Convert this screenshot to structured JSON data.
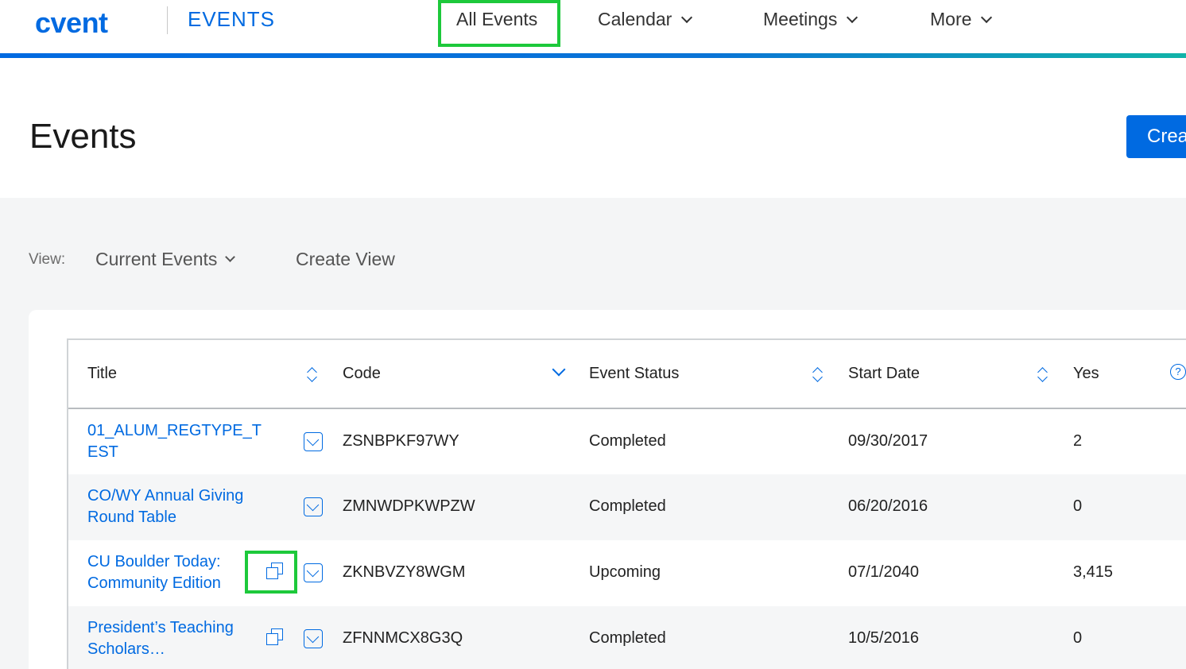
{
  "topnav": {
    "logo": "cvent",
    "app_name": "EVENTS",
    "items": [
      {
        "label": "All Events"
      },
      {
        "label": "Calendar"
      },
      {
        "label": "Meetings"
      },
      {
        "label": "More"
      }
    ]
  },
  "header": {
    "title": "Events",
    "create_button": "Crea"
  },
  "view": {
    "label": "View:",
    "selected": "Current Events",
    "create_view": "Create View"
  },
  "table": {
    "columns": [
      "Title",
      "Code",
      "Event Status",
      "Start Date",
      "Yes"
    ],
    "help_glyph": "?",
    "rows": [
      {
        "title": "01_ALUM_REGTYPE_T EST",
        "code": "ZSNBPKF97WY",
        "status": "Completed",
        "start_date": "09/30/2017",
        "yes": "2"
      },
      {
        "title": "CO/WY Annual Giving Round Table",
        "code": "ZMNWDPKWPZW",
        "status": "Completed",
        "start_date": "06/20/2016",
        "yes": "0"
      },
      {
        "title": "CU Boulder Today: Community Edition",
        "code": "ZKNBVZY8WGM",
        "status": "Upcoming",
        "start_date": "07/1/2040",
        "yes": "3,415"
      },
      {
        "title": "President’s Teaching Scholars…",
        "code": "ZFNNMCX8G3Q",
        "status": "Completed",
        "start_date": "10/5/2016",
        "yes": "0"
      }
    ]
  },
  "colors": {
    "accent": "#006ae1",
    "highlight": "#1dc93b"
  }
}
